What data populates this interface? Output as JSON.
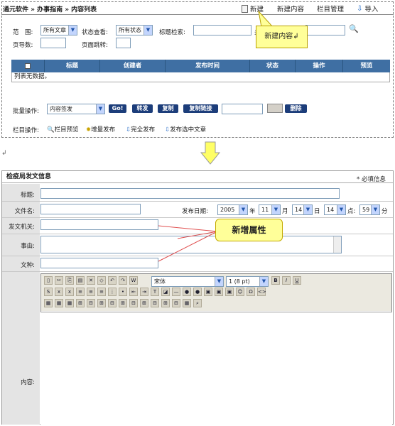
{
  "breadcrumb": "通元软件 » 办事指南 » 内容列表",
  "toolbar": {
    "new": "新建",
    "new_content": "新建内容",
    "column_manage": "栏目管理",
    "import": "导入"
  },
  "callout_new": "新建内容↲",
  "filters": {
    "scope_label": "范　围:",
    "scope_value": "所有文章",
    "status_label": "状态查看:",
    "status_value": "所有状态",
    "title_search_label": "标题检索:",
    "search_trailing": "关",
    "page_size_label": "页导数:",
    "page_jump_label": "页面跳转:"
  },
  "table": {
    "columns": [
      "标题",
      "创建者",
      "发布时间",
      "状态",
      "操作",
      "预览"
    ],
    "empty": "列表无数据。"
  },
  "batch": {
    "label": "批量操作:",
    "select": "内容签发",
    "go": "Go!",
    "forward": "转发",
    "copy": "复制",
    "copy_link": "复制链接",
    "delete": "删除"
  },
  "column_ops": {
    "label": "栏目操作:",
    "preview": "栏目预览",
    "incremental": "增量发布",
    "full": "完全发布",
    "selected": "发布选中文章"
  },
  "return_mark": "↲",
  "form": {
    "header": "检疫局发文信息",
    "required": "* 必填信息",
    "title": "标题:",
    "filename": "文件名:",
    "publish_date": "发布日期:",
    "year": "2005",
    "year_suffix": "年",
    "month": "11",
    "month_suffix": "月",
    "day": "14",
    "day_suffix": "日",
    "hour": "14",
    "hour_suffix": "点:",
    "minute": "59",
    "minute_suffix": "分",
    "agency": "发文机关:",
    "reason": "事由:",
    "doctype": "文种:",
    "content": "内容:"
  },
  "callout_attr": "新增属性",
  "editor": {
    "font": "宋体",
    "size": "1 (8 pt)"
  }
}
